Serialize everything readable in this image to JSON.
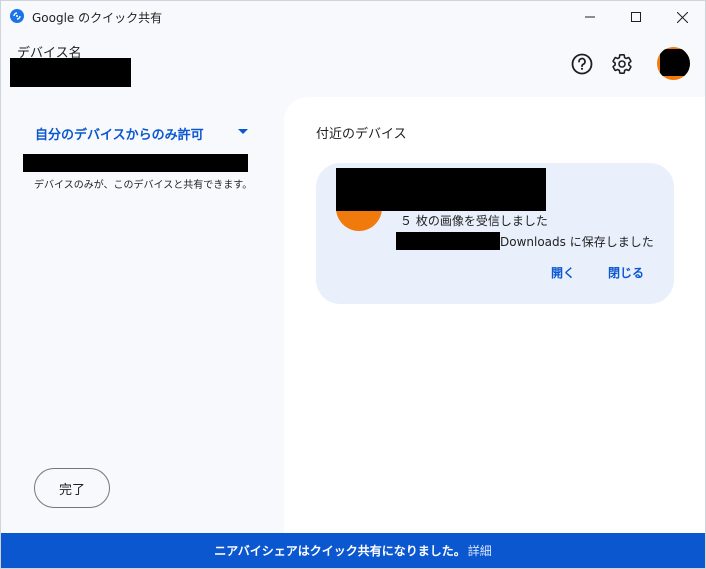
{
  "window": {
    "title": "Google のクイック共有",
    "controls": {
      "minimize": "minimize",
      "maximize": "maximize",
      "close": "close"
    }
  },
  "header": {
    "device_label": "デバイス名",
    "device_name": "",
    "icons": {
      "help": "help-circle-icon",
      "settings": "gear-icon",
      "avatar": "avatar"
    }
  },
  "sidebar": {
    "visibility_selected": "自分のデバイスからのみ許可",
    "visibility_description": "デバイスのみが、このデバイスと共有できます。",
    "done_label": "完了"
  },
  "nearby": {
    "title": "付近のデバイス",
    "card": {
      "status": "５ 枚の画像を受信しました",
      "saved_to": "Downloads に保存しました",
      "open_label": "開く",
      "close_label": "閉じる"
    }
  },
  "banner": {
    "text": "ニアバイシェアはクイック共有になりました。",
    "link": "詳細"
  },
  "colors": {
    "accent": "#0b57d0",
    "avatar": "#f07b0c",
    "card_bg": "#eaf0fb",
    "panel_bg": "#f8f9fc"
  }
}
